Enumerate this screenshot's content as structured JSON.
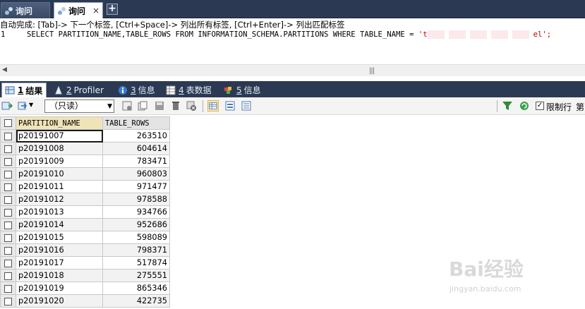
{
  "tabs": [
    {
      "label": "询问",
      "active": false
    },
    {
      "label": "询问",
      "active": true
    }
  ],
  "tab_close": "×",
  "new_tab": "+",
  "editor": {
    "hint": "自动完成: [Tab]-> 下一个标签, [Ctrl+Space]-> 列出所有标签, [Ctrl+Enter]-> 列出匹配标签",
    "line_number": "1",
    "sql_prefix": "SELECT PARTITION_NAME,TABLE_ROWS FROM INFORMATION_SCHEMA.PARTITIONS WHERE TABLE_NAME = ",
    "sql_str_start": "'t",
    "sql_str_end": "el';"
  },
  "result_tabs": [
    {
      "num": "1",
      "label": "结果",
      "active": true
    },
    {
      "num": "2",
      "label": "Profiler",
      "active": false
    },
    {
      "num": "3",
      "label": "信息",
      "active": false
    },
    {
      "num": "4",
      "label": "表数据",
      "active": false
    },
    {
      "num": "5",
      "label": "信息",
      "active": false
    }
  ],
  "toolbar": {
    "mode": "（只读）",
    "limit_label": "限制行",
    "limit_label2": "第",
    "limit_checked": true
  },
  "grid": {
    "columns": [
      "PARTITION_NAME",
      "TABLE_ROWS"
    ],
    "rows": [
      [
        "p20191007",
        "263510"
      ],
      [
        "p20191008",
        "604614"
      ],
      [
        "p20191009",
        "783471"
      ],
      [
        "p20191010",
        "960803"
      ],
      [
        "p20191011",
        "971477"
      ],
      [
        "p20191012",
        "978588"
      ],
      [
        "p20191013",
        "934766"
      ],
      [
        "p20191014",
        "952686"
      ],
      [
        "p20191015",
        "598089"
      ],
      [
        "p20191016",
        "798371"
      ],
      [
        "p20191017",
        "517874"
      ],
      [
        "p20191018",
        "275551"
      ],
      [
        "p20191019",
        "865346"
      ],
      [
        "p20191020",
        "422735"
      ]
    ]
  },
  "watermark": {
    "brand": "Bai经验",
    "url": "jingyan.baidu.com"
  },
  "colors": {
    "tabbar_bg": "#2b3a52",
    "string_literal": "#c00000",
    "header_highlight": "#efe3b8"
  }
}
